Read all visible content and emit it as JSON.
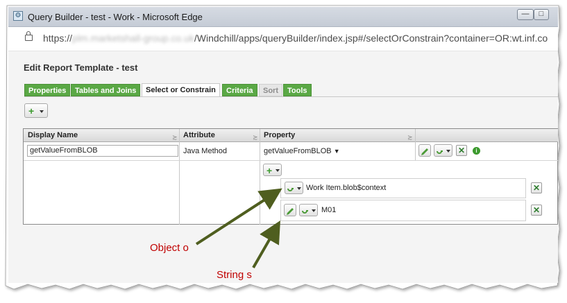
{
  "window": {
    "title": "Query Builder - test - Work - Microsoft Edge",
    "minimize": "—",
    "restore": "□"
  },
  "address_bar": {
    "url_prefix": "https://",
    "url_blurred": "plm.marketshall-group.co.uk",
    "url_path": "/Windchill/apps/queryBuilder/index.jsp#/selectOrConstrain?container=OR:wt.inf.co"
  },
  "page": {
    "title": "Edit Report Template - test",
    "tabs": [
      {
        "label": "Properties",
        "state": "green"
      },
      {
        "label": "Tables and Joins",
        "state": "green"
      },
      {
        "label": "Select or Constrain",
        "state": "selected"
      },
      {
        "label": "Criteria",
        "state": "green"
      },
      {
        "label": "Sort",
        "state": "disabled"
      },
      {
        "label": "Tools",
        "state": "green"
      }
    ],
    "add_button": "+"
  },
  "grid": {
    "headers": [
      "Display Name",
      "Attribute",
      "Property"
    ],
    "row": {
      "display_name": "getValueFromBLOB",
      "attribute": "Java Method",
      "property": "getValueFromBLOB"
    },
    "parameters": [
      {
        "value": "Work Item.blob$context"
      },
      {
        "value": "M01"
      }
    ]
  },
  "annotations": {
    "object": "Object o",
    "string": "String s"
  },
  "colors": {
    "tab_green": "#5aa845",
    "annotation_red": "#c00000",
    "arrow": "#4f5e1f"
  },
  "icons": [
    "app-icon",
    "lock-icon",
    "plus-icon",
    "pencil-icon",
    "link-icon",
    "remove-icon",
    "info-icon",
    "caret-down-icon"
  ]
}
